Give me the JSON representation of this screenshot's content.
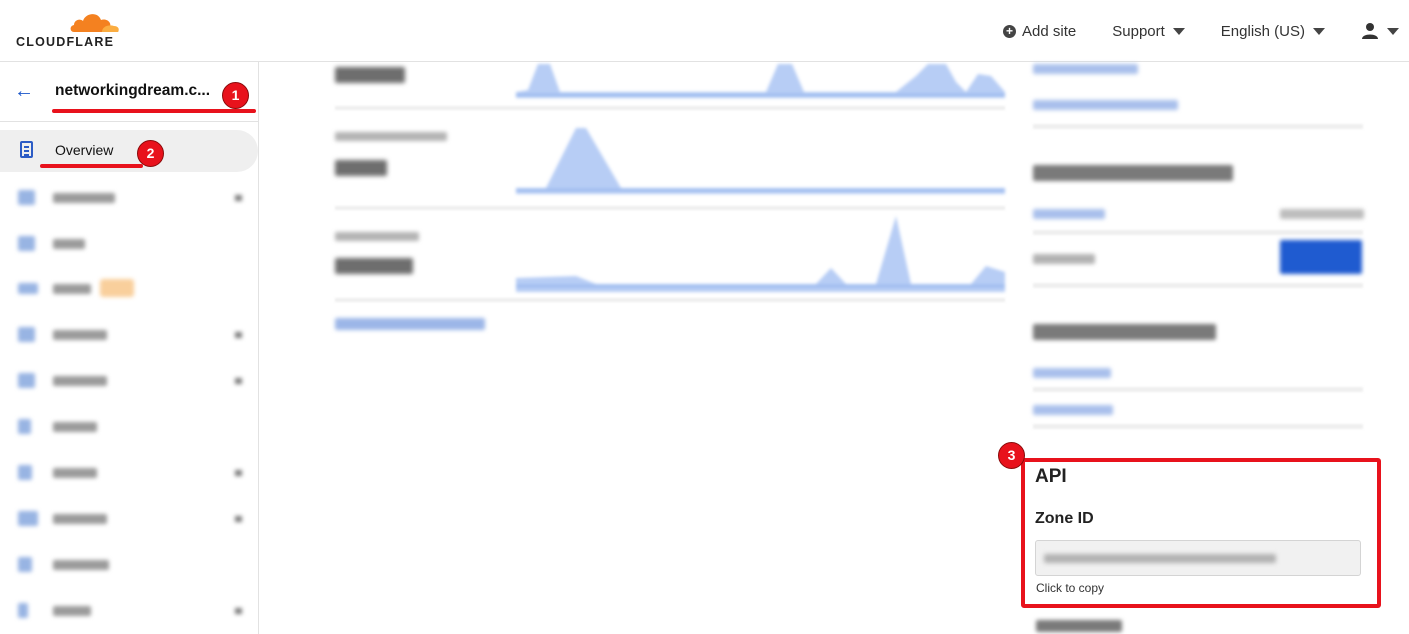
{
  "header": {
    "logo_text": "CLOUDFLARE",
    "add_site": "Add site",
    "support": "Support",
    "language": "English (US)"
  },
  "sidebar": {
    "site_name": "networkingdream.c...",
    "active_item": "Overview"
  },
  "api": {
    "title": "API",
    "zone_id_label": "Zone ID",
    "copy_hint": "Click to copy"
  },
  "annotations": {
    "badge_1": "1",
    "badge_2": "2",
    "badge_3": "3",
    "color": "#e8121c"
  },
  "colors": {
    "brand_orange": "#f48120",
    "link_blue": "#1a56c9",
    "chart_fill": "#b7cdf5"
  }
}
